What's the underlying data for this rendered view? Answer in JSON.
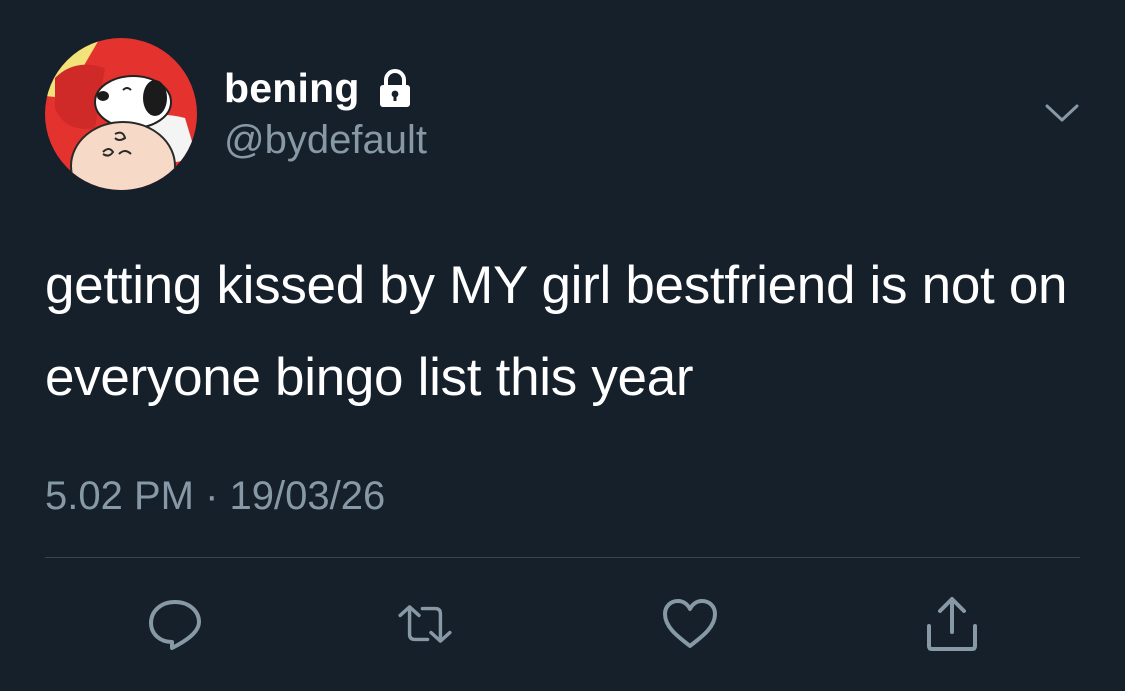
{
  "tweet": {
    "display_name": "bening",
    "handle": "@bydefault",
    "protected_icon": "lock-icon",
    "text": "getting kissed by MY girl bestfriend is not on everyone bingo list this year",
    "timestamp": "5.02 PM · 19/03/26"
  },
  "actions": [
    {
      "name": "reply",
      "icon": "reply-icon"
    },
    {
      "name": "retweet",
      "icon": "retweet-icon"
    },
    {
      "name": "like",
      "icon": "heart-icon"
    },
    {
      "name": "share",
      "icon": "share-icon"
    }
  ],
  "colors": {
    "background": "#15202b",
    "primary_text": "#ffffff",
    "secondary_text": "#8899a6",
    "divider": "#38444d"
  }
}
